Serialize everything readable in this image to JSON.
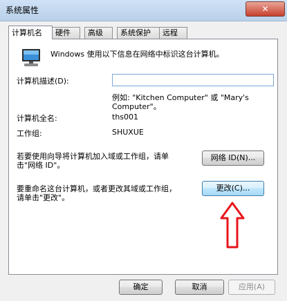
{
  "window": {
    "title": "系统属性",
    "close_label": "✕"
  },
  "tabs": [
    {
      "label": "计算机名",
      "active": true
    },
    {
      "label": "硬件",
      "active": false
    },
    {
      "label": "高级",
      "active": false
    },
    {
      "label": "系统保护",
      "active": false
    },
    {
      "label": "远程",
      "active": false
    }
  ],
  "panel": {
    "intro": "Windows 使用以下信息在网络中标识这台计算机。",
    "description_label": "计算机描述(D):",
    "description_value": "",
    "example_line1": "例如: \"Kitchen Computer\" 或 \"Mary's",
    "example_line2": "Computer\"。",
    "full_name_label": "计算机全名:",
    "full_name_value": "ths001",
    "workgroup_label": "工作组:",
    "workgroup_value": "SHUXUE",
    "network_text_line1": "若要使用向导将计算机加入域或工作组，请单",
    "network_text_line2": "击\"网络 ID\"。",
    "network_id_button": "网络 ID(N)...",
    "rename_text_line1": "要重命名这台计算机，或者更改其域或工作组，",
    "rename_text_line2": "请单击\"更改\"。",
    "change_button": "更改(C)..."
  },
  "footer": {
    "ok_button": "确定",
    "cancel_button": "取消",
    "apply_button": "应用(A)"
  },
  "icons": {
    "computer": "computer-icon",
    "annotation_arrow": "red-up-arrow-icon"
  },
  "colors": {
    "arrow": "#e8141b",
    "title_bar": "#b9d1ea"
  }
}
